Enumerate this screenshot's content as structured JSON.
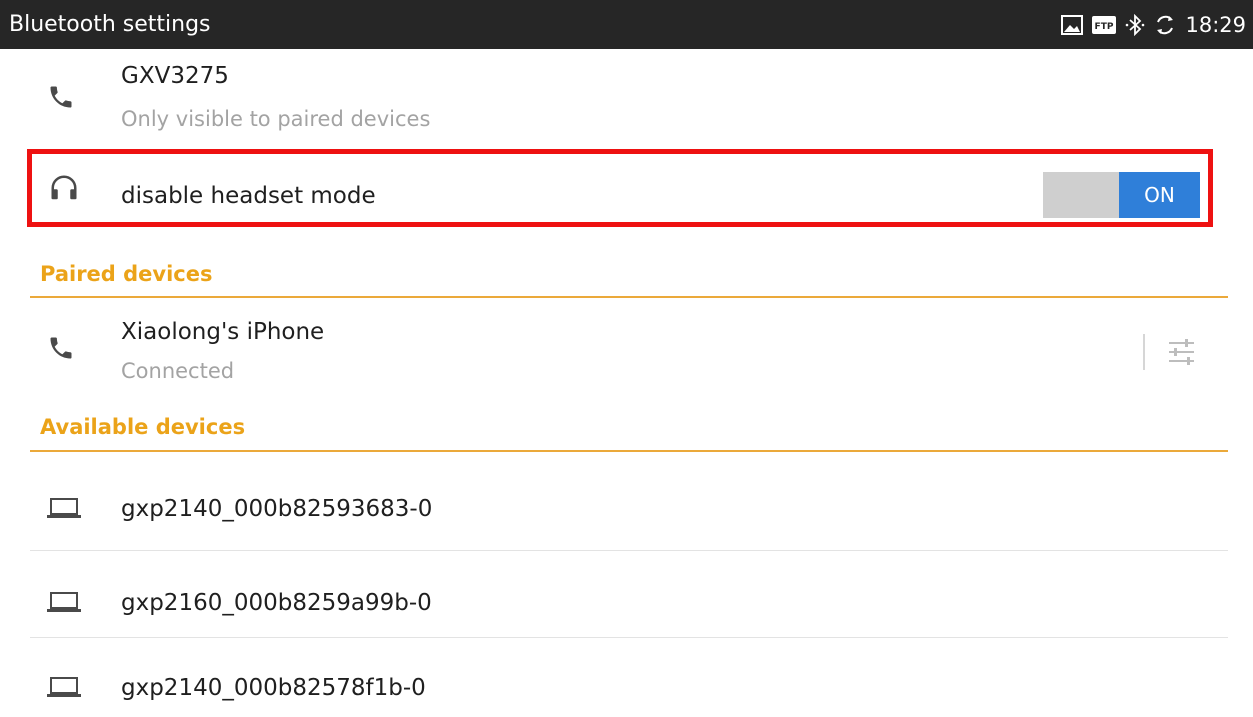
{
  "statusbar": {
    "title": "Bluetooth settings",
    "time": "18:29",
    "icons": [
      "image-icon",
      "ftp-icon",
      "bluetooth-icon",
      "sync-icon"
    ]
  },
  "device": {
    "name": "GXV3275",
    "visibility": "Only visible to paired devices",
    "icon": "phone-icon"
  },
  "headset": {
    "label": "disable headset mode",
    "icon": "headset-icon",
    "toggle_label": "ON",
    "toggle_state": true
  },
  "paired": {
    "header": "Paired devices",
    "items": [
      {
        "name": "Xiaolong's iPhone",
        "status": "Connected",
        "icon": "phone-icon"
      }
    ]
  },
  "available": {
    "header": "Available devices",
    "items": [
      {
        "name": "gxp2140_000b82593683-0",
        "icon": "laptop-icon"
      },
      {
        "name": "gxp2160_000b8259a99b-0",
        "icon": "laptop-icon"
      },
      {
        "name": "gxp2140_000b82578f1b-0",
        "icon": "laptop-icon"
      }
    ]
  },
  "colors": {
    "statusbar": "#262626",
    "section_header": "#eba319",
    "highlight_border": "#ee1111",
    "toggle_on": "#2f7fd9",
    "toggle_off": "#cfcfcf"
  }
}
